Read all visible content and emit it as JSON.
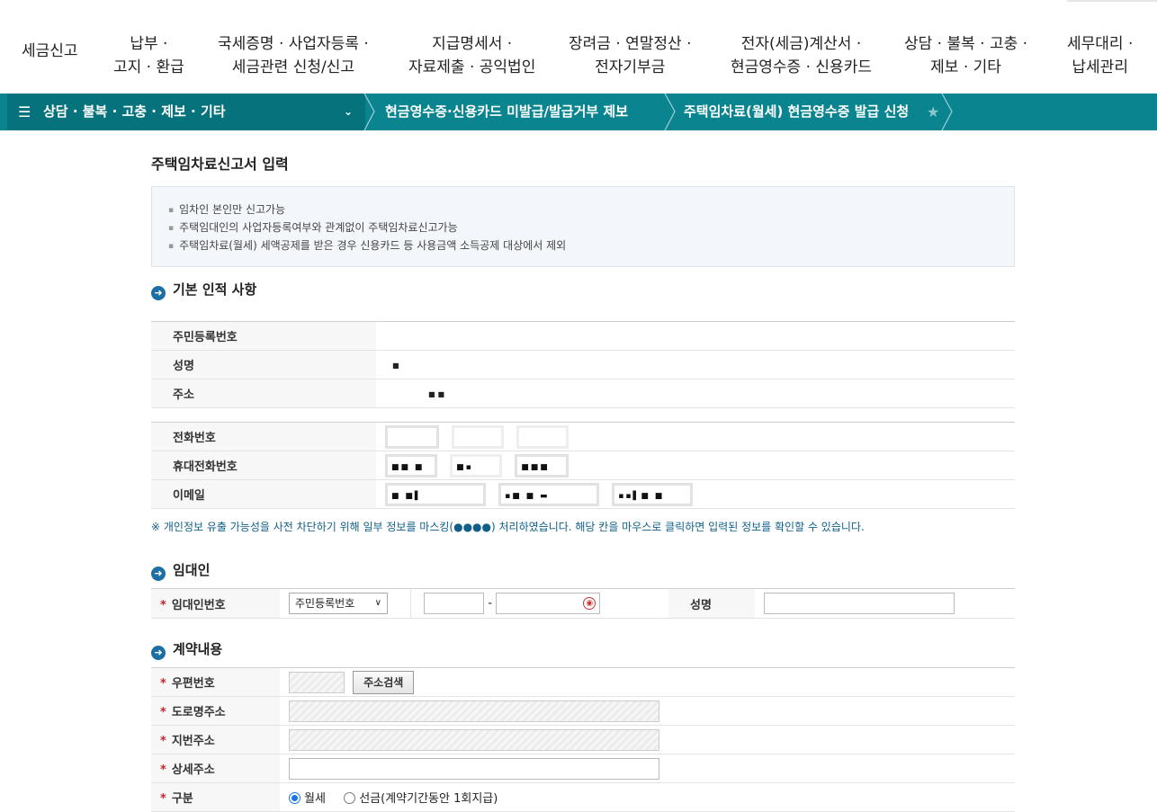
{
  "topnav": {
    "items": [
      "세금신고",
      "납부 ·\n고지 · 환급",
      "국세증명 · 사업자등록 ·\n세금관련 신청/신고",
      "지급명세서 ·\n자료제출 · 공익법인",
      "장려금 · 연말정산 ·\n전자기부금",
      "전자(세금)계산서 ·\n현금영수증 · 신용카드",
      "상담 · 불복 · 고충 ·\n제보 · 기타",
      "세무대리 ·\n납세관리"
    ]
  },
  "breadcrumb": {
    "menu_icon": "hamburger-icon",
    "items": [
      "상담 · 불복 · 고충 · 제보 · 기타",
      "현금영수증·신용카드 미발급/발급거부 제보",
      "주택임차료(월세) 현금영수증 발급 신청"
    ],
    "star_icon": "star-icon"
  },
  "page": {
    "title": "주택임차료신고서 입력",
    "info": [
      "임차인 본인만 신고가능",
      "주택임대인의 사업자등록여부와 관계없이 주택임차료신고가능",
      "주택임차료(월세) 세액공제를 받은 경우 신용카드 등 사용금액 소득공제 대상에서 제외"
    ]
  },
  "basic": {
    "heading": "기본 인적 사항",
    "rows": [
      "주민등록번호",
      "성명",
      "주소"
    ],
    "contact_rows": [
      "전화번호",
      "휴대전화번호",
      "이메일"
    ],
    "note": "※ 개인정보 유출 가능성을 사전 차단하기 위해 일부 정보를 마스킹(●●●●) 처리하였습니다. 해당 칸을 마우스로 클릭하면 입력된 정보를 확인할 수 있습니다."
  },
  "landlord": {
    "heading": "임대인",
    "id_label": "임대인번호",
    "id_type": "주민등록번호",
    "dash": "-",
    "name_label": "성명"
  },
  "contract": {
    "heading": "계약내용",
    "zip_label": "우편번호",
    "search_button": "주소검색",
    "road_label": "도로명주소",
    "jibun_label": "지번주소",
    "detail_label": "상세주소",
    "type_label": "구분",
    "type_monthly": "월세",
    "type_lumpsum": "선금(계약기간동안 1회지급)"
  }
}
